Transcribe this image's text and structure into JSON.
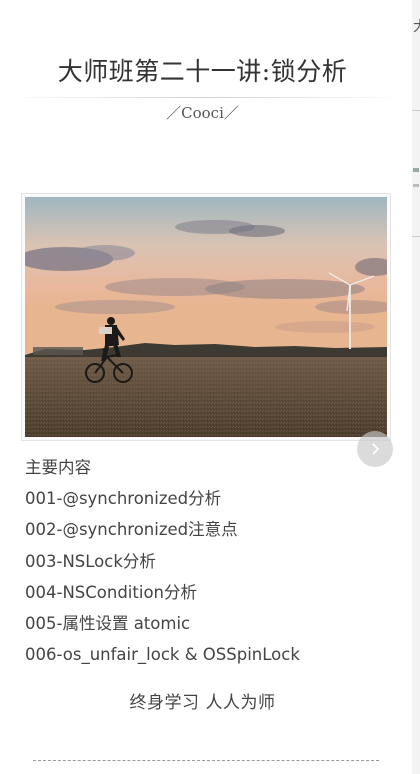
{
  "page": {
    "title": "大师班第二十一讲:锁分析",
    "author": "／Cooci／",
    "side_fragment": "大"
  },
  "cover_image": {
    "description_icon": "photo-cyclist-wind-turbine",
    "next_icon": "chevron-right-icon"
  },
  "contents": {
    "heading": "主要内容",
    "items": [
      "001-@synchronized分析",
      "002-@synchronized注意点",
      "003-NSLock分析",
      "004-NSCondition分析",
      "005-属性设置 atomic",
      "006-os_unfair_lock & OSSpinLock"
    ]
  },
  "footer": {
    "motto": "终身学习 人人为师"
  },
  "colors": {
    "text": "#444444",
    "title": "#333333",
    "divider": "#9a9a9a"
  }
}
